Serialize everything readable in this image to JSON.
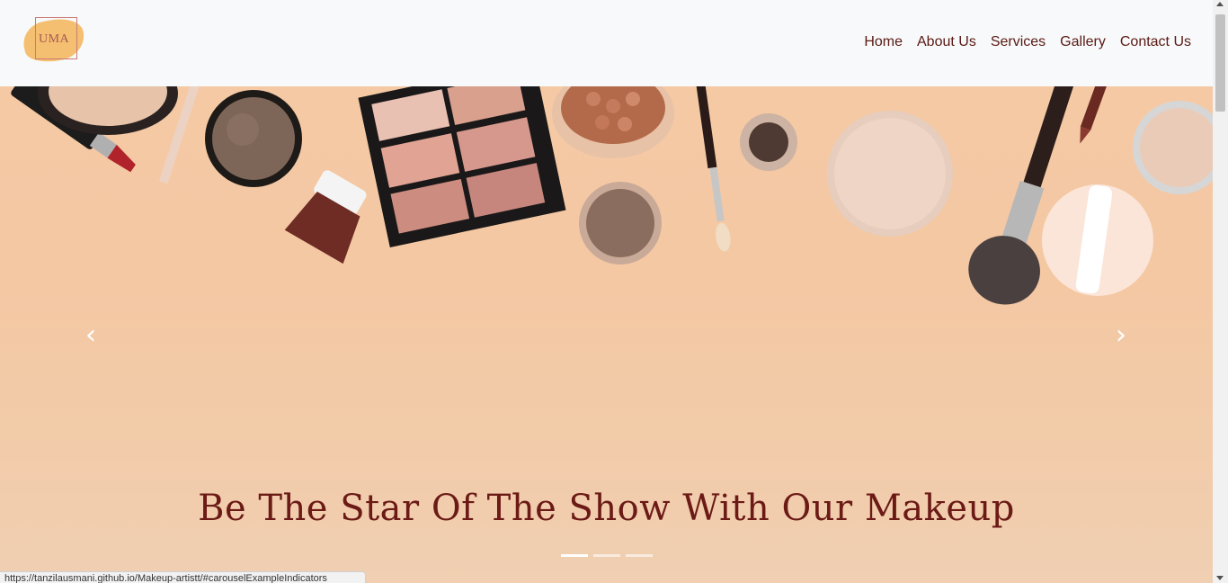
{
  "header": {
    "logo_text": "UMA",
    "nav": [
      "Home",
      "About Us",
      "Services",
      "Gallery",
      "Contact Us"
    ]
  },
  "carousel": {
    "caption": "Be The Star Of The Show With Our Makeup",
    "prev_icon": "chevron-left-icon",
    "next_icon": "chevron-right-icon",
    "indicator_count": 3,
    "active_indicator": 0
  },
  "status_bar": {
    "url": "https://tanzilausmani.github.io/Makeup-artistt/#carouselExampleIndicators"
  },
  "colors": {
    "accent": "#6b1a15",
    "hero_bg": "#f4c8a3",
    "logo_orange": "#f4b862"
  }
}
